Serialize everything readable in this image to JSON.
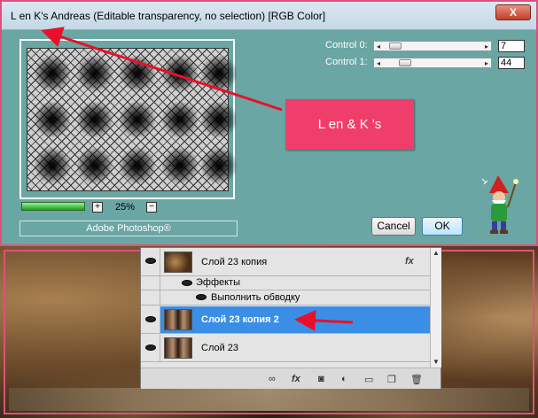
{
  "dialog": {
    "title": "L en K's Andreas (Editable transparency, no selection) [RGB Color]",
    "close_glyph": "X",
    "zoom": "25%",
    "zoom_in": "+",
    "zoom_out": "−",
    "progress": 1.0,
    "brand": "Adobe Photoshop®",
    "controls": [
      {
        "label": "Control 0:",
        "value": "7",
        "fraction": 0.05
      },
      {
        "label": "Control 1:",
        "value": "44",
        "fraction": 0.17
      }
    ],
    "cancel_label": "Cancel",
    "ok_label": "OK",
    "overlay_label": "L en & K 's"
  },
  "layers": {
    "rows": [
      {
        "name": "Слой 23 копия",
        "fx": "fx"
      },
      {
        "name": "Эффекты"
      },
      {
        "name": "Выполнить обводку"
      },
      {
        "name": "Слой 23 копия 2"
      },
      {
        "name": "Слой 23"
      }
    ],
    "footer_icons": [
      "link-icon",
      "fx-icon",
      "mask-icon",
      "adjustment-icon",
      "group-icon",
      "new-layer-icon",
      "trash-icon"
    ],
    "footer_fx": "fx"
  },
  "colors": {
    "dialog_bg": "#6aa6a3",
    "accent_pink": "#f03e6a",
    "selection_blue": "#3a8ee6",
    "arrow_red": "#e8102a"
  }
}
